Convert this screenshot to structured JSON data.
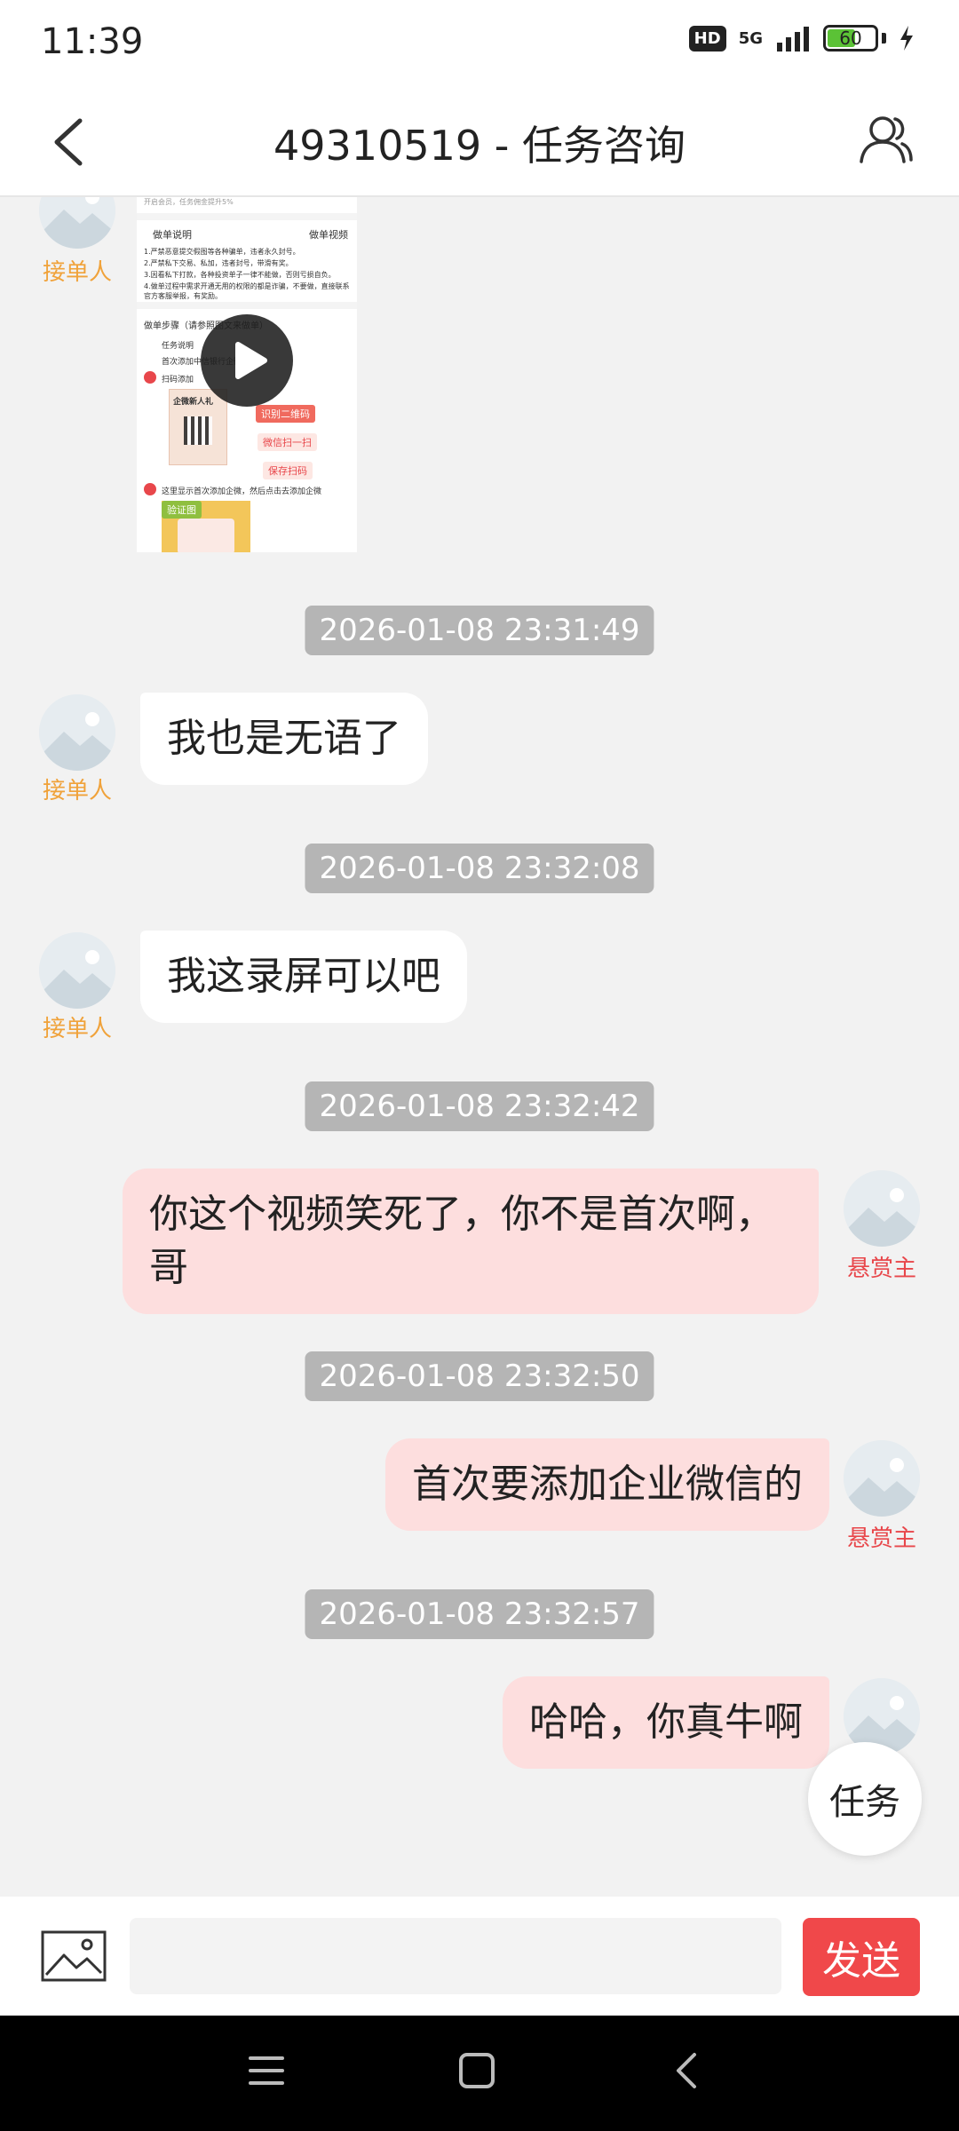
{
  "status_bar": {
    "time": "11:39",
    "hd": "HD",
    "network": "5G",
    "battery": "60",
    "battery_level": 0.6
  },
  "header": {
    "title": "49310519 - 任务咨询",
    "back_icon": "chevron-left-icon",
    "profile_icon": "users-icon"
  },
  "roles": {
    "receiver": "接单人",
    "poster": "悬赏主"
  },
  "screenshot": {
    "line_top": "开启会员，任务佣金提升5%",
    "notice_title": "做单说明",
    "notice_video": "做单视频",
    "notice_lines": [
      "1.严禁恶意提交假图等各种骗单，违者永久封号。",
      "2.严禁私下交易、私加，违者封号，带滑有奖。",
      "3.因看私下打款，各种投资单子一律不能做，否则亏损自负。",
      "4.做单过程中需求开通无用的权限的都是诈骗，不要做，直接联系官方客服举报，有奖励。"
    ],
    "steps_title": "做单步骤（请参照图文来做单）",
    "task_desc_label": "任务说明",
    "task_desc": "首次添加中信银行企微",
    "step1_label": "扫码添加",
    "tag_identify": "识别二维码",
    "tag_scan": "微信扫一扫",
    "tag_save": "保存扫码",
    "promo_text": "企微新人礼",
    "step2_text": "这里显示首次添加企微，然后点击去添加企微",
    "verify_tag": "验证图"
  },
  "messages": [
    {
      "timestamp": "2026-01-08 23:31:49",
      "side": "left",
      "text": "我也是无语了"
    },
    {
      "timestamp": "2026-01-08 23:32:08",
      "side": "left",
      "text": "我这录屏可以吧"
    },
    {
      "timestamp": "2026-01-08 23:32:42",
      "side": "right",
      "text": "你这个视频笑死了，你不是首次啊，哥"
    },
    {
      "timestamp": "2026-01-08 23:32:50",
      "side": "right",
      "text": "首次要添加企业微信的"
    },
    {
      "timestamp": "2026-01-08 23:32:57",
      "side": "right",
      "text": "哈哈，你真牛啊"
    }
  ],
  "task_button": "任务",
  "input": {
    "placeholder": "",
    "send_label": "发送",
    "image_icon": "image-icon"
  },
  "colors": {
    "accent": "#f0484a",
    "receiver_label": "#f0a23a",
    "poster_label": "#e8474b",
    "bubble_right": "#fddede",
    "bubble_left": "#ffffff",
    "timestamp_bg": "#b5b5b5"
  }
}
